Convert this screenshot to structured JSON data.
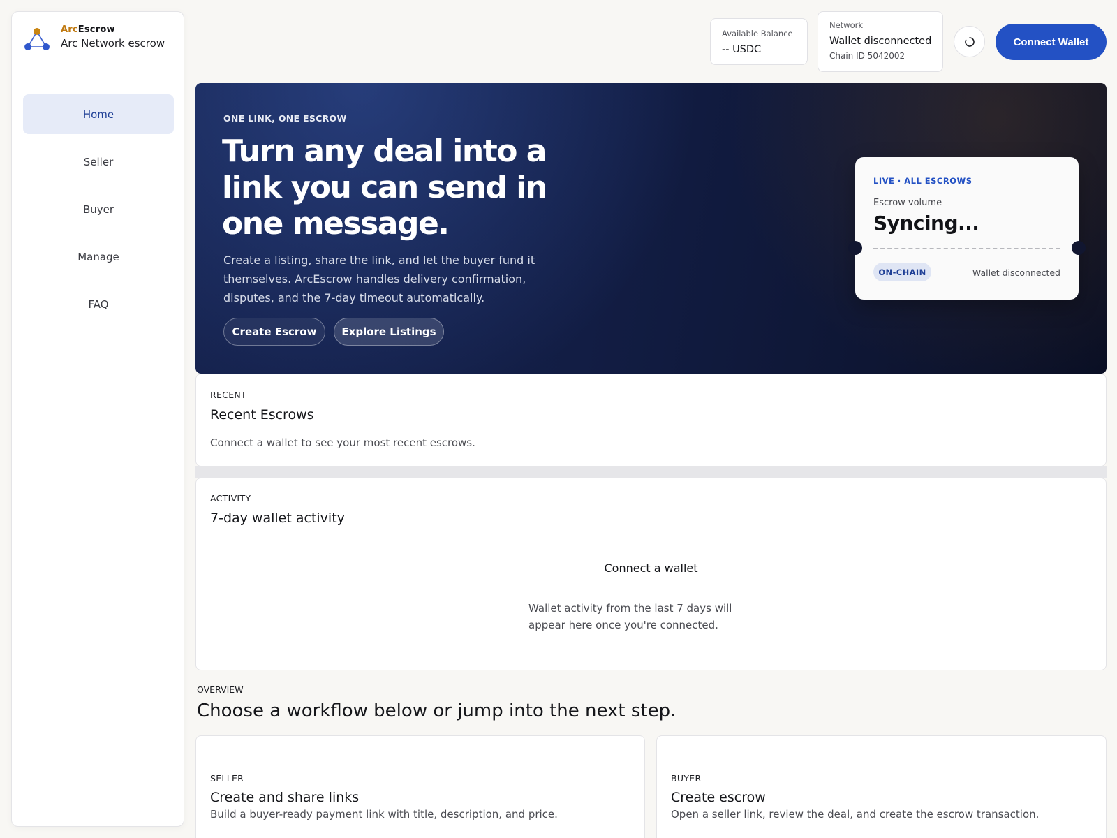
{
  "brand": {
    "name_part1": "Arc",
    "name_part2": "Escrow",
    "subtitle": "Arc Network escrow"
  },
  "nav": [
    {
      "label": "Home",
      "active": true
    },
    {
      "label": "Seller",
      "active": false
    },
    {
      "label": "Buyer",
      "active": false
    },
    {
      "label": "Manage",
      "active": false
    },
    {
      "label": "FAQ",
      "active": false
    }
  ],
  "topbar": {
    "balance_label": "Available Balance",
    "balance_value": "-- USDC",
    "network_label": "Network",
    "network_value": "Wallet disconnected",
    "chain_id": "Chain ID 5042002",
    "connect_label": "Connect Wallet"
  },
  "hero": {
    "eyebrow": "ONE LINK, ONE ESCROW",
    "title": "Turn any deal into a link you can send in one message.",
    "description": "Create a listing, share the link, and let the buyer fund it themselves. ArcEscrow handles delivery confirmation, disputes, and the 7-day timeout automatically.",
    "btn_create": "Create Escrow",
    "btn_explore": "Explore Listings"
  },
  "live_card": {
    "eyebrow": "LIVE · ALL ESCROWS",
    "label": "Escrow volume",
    "value": "Syncing...",
    "badge": "ON-CHAIN",
    "status": "Wallet disconnected"
  },
  "recent": {
    "eyebrow": "RECENT",
    "title": "Recent Escrows",
    "body": "Connect a wallet to see your most recent escrows."
  },
  "activity": {
    "eyebrow": "ACTIVITY",
    "title": "7-day wallet activity",
    "empty_title": "Connect a wallet",
    "empty_desc": "Wallet activity from the last 7 days will appear here once you're connected."
  },
  "overview": {
    "eyebrow": "OVERVIEW",
    "title": "Choose a workflow below or jump into the next step."
  },
  "workflows": {
    "seller": {
      "eyebrow": "SELLER",
      "title": "Create and share links",
      "desc": "Build a buyer-ready payment link with title, description, and price."
    },
    "buyer": {
      "eyebrow": "BUYER",
      "title": "Create escrow",
      "desc": "Open a seller link, review the deal, and create the escrow transaction."
    }
  },
  "colors": {
    "accent": "#2351c4",
    "brand_orange": "#c07a12",
    "hero_bg": "#121d44"
  },
  "icons": {
    "logo": "network-triangle-icon",
    "refresh": "refresh-icon"
  }
}
